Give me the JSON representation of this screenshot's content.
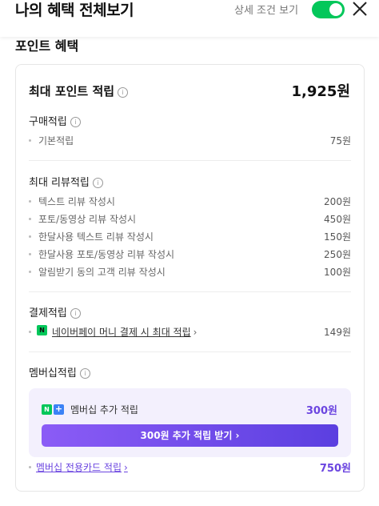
{
  "header": {
    "title": "나의 혜택 전체보기",
    "detail_toggle_label": "상세 조건 보기",
    "detail_toggle_on": true,
    "accent_color": "#03c75a"
  },
  "section": {
    "title": "포인트 혜택"
  },
  "summary": {
    "label": "최대 포인트 적립",
    "value": "1,925원"
  },
  "purchase": {
    "title": "구매적립",
    "items": [
      {
        "label": "기본적립",
        "value": "75원"
      }
    ]
  },
  "review": {
    "title": "최대 리뷰적립",
    "items": [
      {
        "label": "텍스트 리뷰 작성시",
        "value": "200원"
      },
      {
        "label": "포토/동영상 리뷰 작성시",
        "value": "450원"
      },
      {
        "label": "한달사용 텍스트 리뷰 작성시",
        "value": "150원"
      },
      {
        "label": "한달사용 포토/동영상 리뷰 작성시",
        "value": "250원"
      },
      {
        "label": "알림받기 동의 고객 리뷰 작성시",
        "value": "100원"
      }
    ]
  },
  "payment": {
    "title": "결제적립",
    "items": [
      {
        "icon": "naver-pay-icon",
        "label": "네이버페이 머니 결제 시 최대 적립",
        "value": "149원"
      }
    ]
  },
  "membership": {
    "title": "멤버십적립",
    "box": {
      "label": "멤버십 추가 적립",
      "value": "300원",
      "button_label": "300원 추가 적립 받기 ›",
      "accent_color": "#6b45e0"
    },
    "card_link": {
      "label": "멤버십 전용카드 적립",
      "value": "750원"
    }
  }
}
